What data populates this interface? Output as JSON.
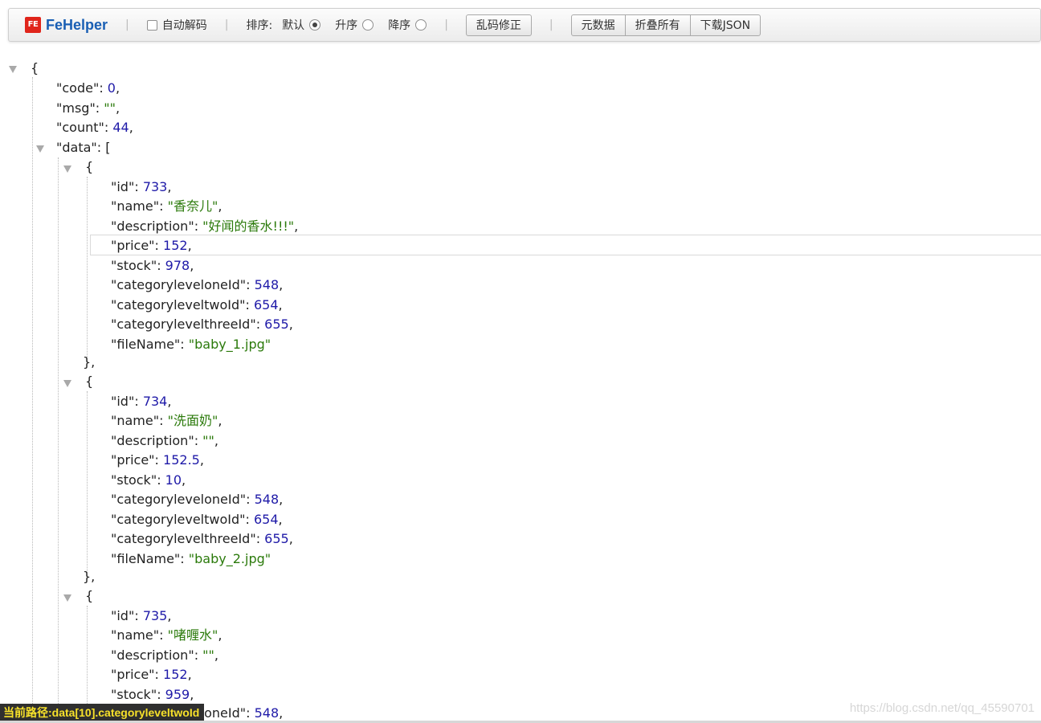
{
  "toolbar": {
    "brand_logo": "FE",
    "brand_name": "FeHelper",
    "auto_decode_label": "自动解码",
    "sort_label": "排序:",
    "sort_default": "默认",
    "sort_asc": "升序",
    "sort_desc": "降序",
    "fix_garbled_label": "乱码修正",
    "metadata_label": "元数据",
    "collapse_all_label": "折叠所有",
    "download_json_label": "下载JSON",
    "separator": "|"
  },
  "json": {
    "root_open": "{",
    "code_key": "\"code\"",
    "code_val": "0",
    "msg_key": "\"msg\"",
    "msg_val": "\"\"",
    "count_key": "\"count\"",
    "count_val": "44",
    "data_key": "\"data\"",
    "data_open": "[",
    "items": [
      {
        "id": "733",
        "name": "\"香奈儿\"",
        "description": "\"好闻的香水!!!\"",
        "price": "152",
        "stock": "978",
        "categoryleveloneId": "548",
        "categoryleveltwoId": "654",
        "categorylevelthreeId": "655",
        "fileName": "\"baby_1.jpg\""
      },
      {
        "id": "734",
        "name": "\"洗面奶\"",
        "description": "\"\"",
        "price": "152.5",
        "stock": "10",
        "categoryleveloneId": "548",
        "categoryleveltwoId": "654",
        "categorylevelthreeId": "655",
        "fileName": "\"baby_2.jpg\""
      },
      {
        "id": "735",
        "name": "\"啫喱水\"",
        "description": "\"\"",
        "price": "152",
        "stock": "959",
        "categoryleveloneId": "548"
      }
    ]
  },
  "status_bar": {
    "label": "当前路径:",
    "path": "data[10].categoryleveltwoId"
  },
  "watermark": "https://blog.csdn.net/qq_45590701"
}
